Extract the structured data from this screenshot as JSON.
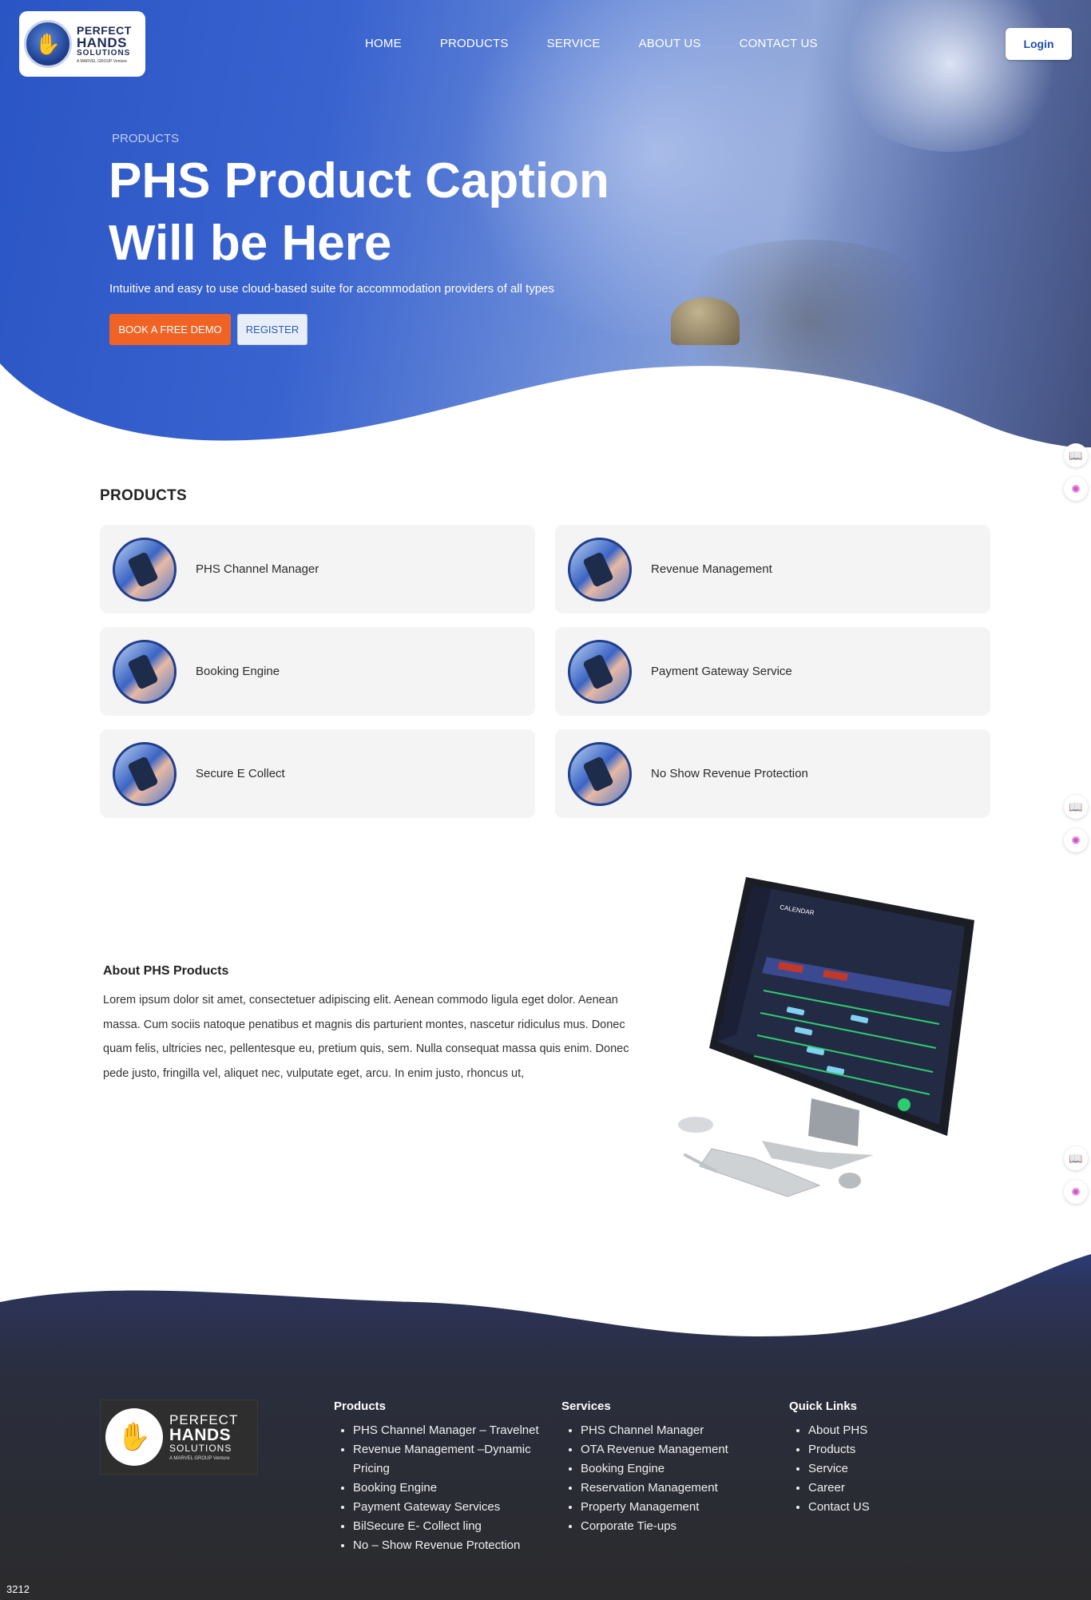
{
  "logo": {
    "line1": "PERFECT",
    "line2": "HANDS",
    "line3": "SOLUTIONS",
    "tagline": "A MARVEL GROUP Venture"
  },
  "nav": {
    "items": [
      {
        "label": "HOME"
      },
      {
        "label": "PRODUCTS"
      },
      {
        "label": "SERVICE"
      },
      {
        "label": "ABOUT US"
      },
      {
        "label": "CONTACT US"
      }
    ],
    "login_label": "Login"
  },
  "hero": {
    "eyebrow": "PRODUCTS",
    "title": "PHS Product Caption Will be Here",
    "subtitle": "Intuitive and easy to use cloud-based suite for accommodation providers of all types",
    "demo_label": "BOOK A FREE DEMO",
    "register_label": "REGISTER"
  },
  "products": {
    "heading": "PRODUCTS",
    "items": [
      {
        "label": "PHS Channel Manager"
      },
      {
        "label": "Revenue Management"
      },
      {
        "label": "Booking Engine"
      },
      {
        "label": "Payment Gateway Service"
      },
      {
        "label": "Secure E Collect"
      },
      {
        "label": "No Show Revenue Protection"
      }
    ]
  },
  "about": {
    "title": "About PHS Products",
    "text": "Lorem ipsum dolor sit amet, consectetuer adipiscing elit. Aenean commodo ligula eget dolor. Aenean massa. Cum sociis natoque penatibus et magnis dis parturient montes, nascetur ridiculus mus. Donec quam felis, ultricies nec, pellentesque eu, pretium quis, sem. Nulla consequat massa quis enim. Donec pede justo, fringilla vel, aliquet nec, vulputate eget, arcu. In enim justo, rhoncus ut,"
  },
  "monitor_screen": {
    "title": "CALENDAR"
  },
  "footer": {
    "logo": {
      "line1": "PERFECT",
      "line2": "HANDS",
      "line3": "SOLUTIONS",
      "tagline": "A MARVEL GROUP Venture"
    },
    "products": {
      "heading": "Products",
      "items": [
        "PHS Channel Manager – Travelnet",
        "Revenue Management –Dynamic Pricing",
        "Booking Engine",
        "Payment Gateway Services",
        "BilSecure E- Collect ling",
        "No – Show Revenue Protection"
      ]
    },
    "services": {
      "heading": "Services",
      "items": [
        "PHS Channel Manager",
        "OTA Revenue Management",
        "Booking Engine",
        "Reservation Management",
        "Property Management",
        "Corporate Tie-ups"
      ]
    },
    "quick_links": {
      "heading": "Quick Links",
      "items": [
        "About PHS",
        "Products",
        "Service",
        "Career",
        "Contact US"
      ]
    }
  },
  "counter": "3212",
  "colors": {
    "primary_blue": "#2a55c4",
    "accent_orange": "#f06325",
    "footer_dark": "#2b2b2d",
    "card_bg": "#f4f4f5"
  },
  "icons": {
    "side_book": "book-icon",
    "side_brain": "brain-icon"
  }
}
